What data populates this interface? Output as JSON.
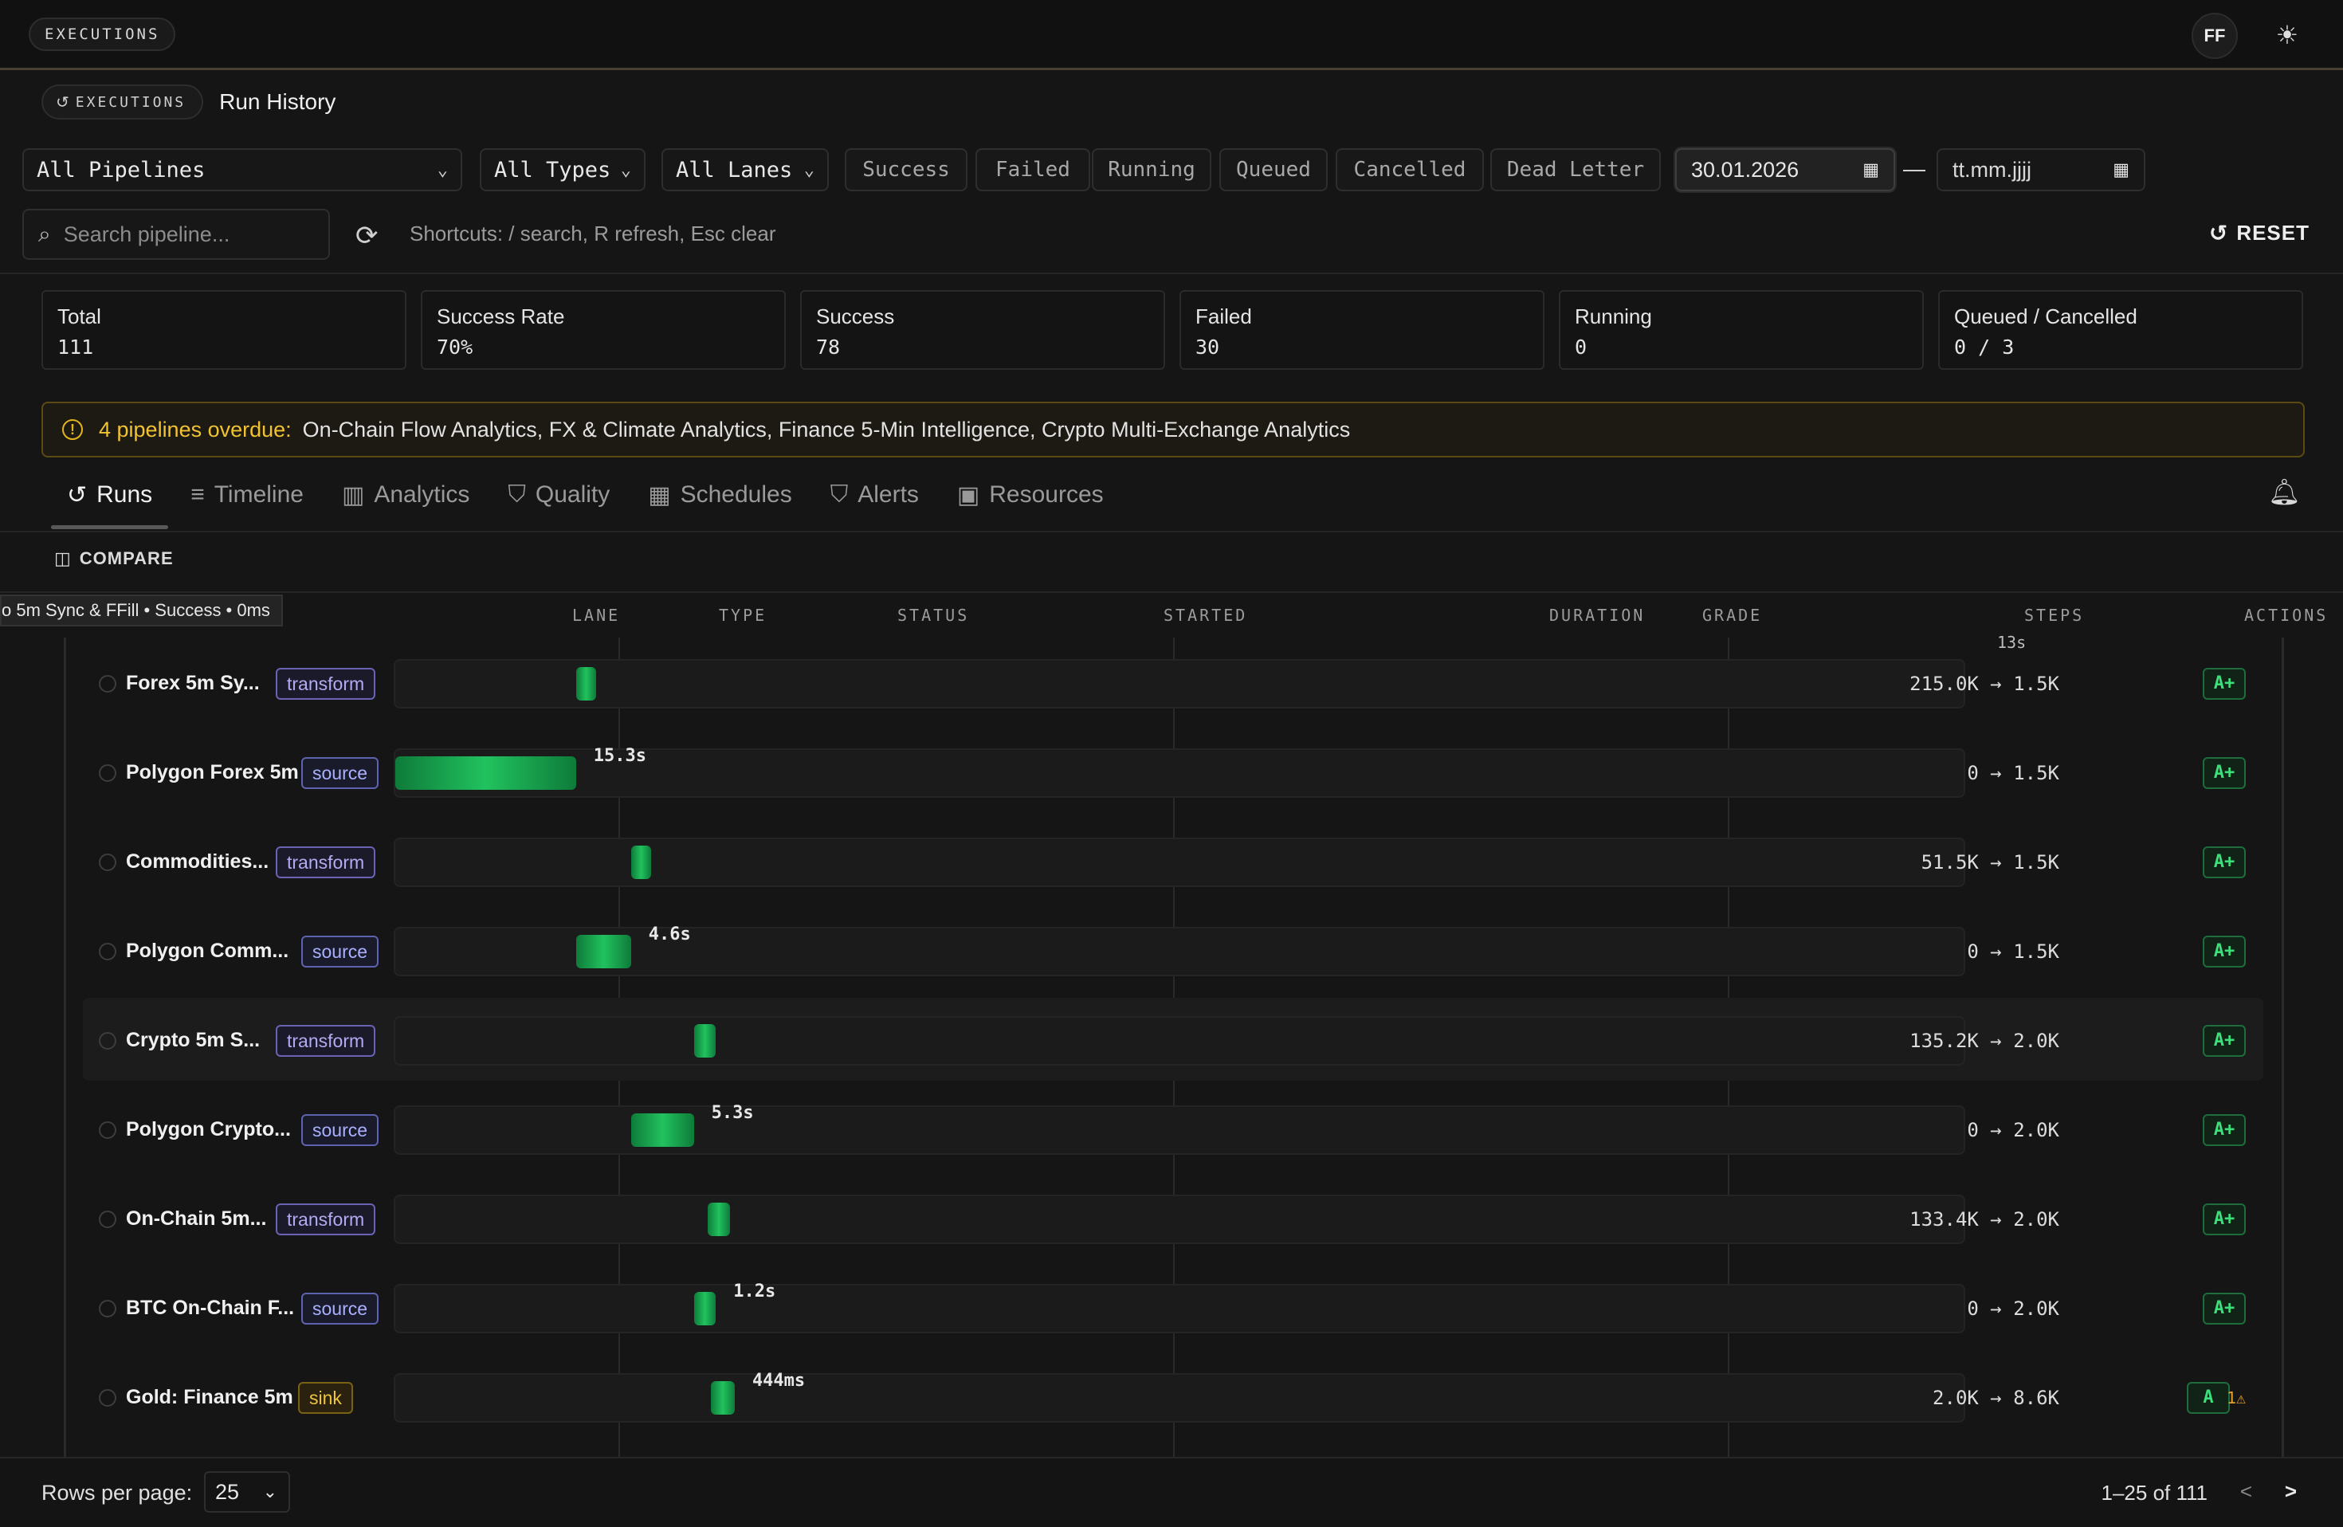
{
  "topbar": {
    "brand": "EXECUTIONS",
    "avatar": "FF",
    "theme_icon": "sun-icon"
  },
  "breadcrumb": {
    "section": "EXECUTIONS",
    "title": "Run History"
  },
  "filters": {
    "pipeline": "All Pipelines",
    "type": "All Types",
    "lane": "All Lanes",
    "statuses": [
      "Success",
      "Failed",
      "Running",
      "Queued",
      "Cancelled",
      "Dead Letter"
    ],
    "date_from": "30.01.2026",
    "date_sep": "—",
    "date_to_placeholder": "tt.mm.jjjj"
  },
  "search": {
    "placeholder": "Search pipeline...",
    "shortcuts": "Shortcuts: / search, R refresh, Esc clear",
    "reset": "RESET"
  },
  "stats": [
    {
      "label": "Total",
      "value": "111"
    },
    {
      "label": "Success Rate",
      "value": "70%"
    },
    {
      "label": "Success",
      "value": "78"
    },
    {
      "label": "Failed",
      "value": "30"
    },
    {
      "label": "Running",
      "value": "0"
    },
    {
      "label": "Queued / Cancelled",
      "value": "0 / 3"
    }
  ],
  "alert": {
    "headline": "4 pipelines overdue:",
    "names": "On-Chain Flow Analytics, FX & Climate Analytics, Finance 5-Min Intelligence, Crypto Multi-Exchange Analytics"
  },
  "tabs": [
    "Runs",
    "Timeline",
    "Analytics",
    "Quality",
    "Schedules",
    "Alerts",
    "Resources"
  ],
  "toolbar": {
    "compare": "COMPARE"
  },
  "tooltip": "o 5m Sync & FFill • Success • 0ms",
  "columns": [
    "LANE",
    "TYPE",
    "STATUS",
    "STARTED",
    "DURATION",
    "GRADE",
    "STEPS",
    "ACTIONS"
  ],
  "top_stub": "13s",
  "rows": [
    {
      "name": "Forex 5m Sy...",
      "lane": "transform",
      "dur": "",
      "start": 0.115,
      "width": 0.013,
      "steps": "215.0K → 1.5K",
      "grade": "A+",
      "warn": ""
    },
    {
      "name": "Polygon Forex 5m",
      "lane": "source",
      "dur": "15.3s",
      "start": 0.0,
      "width": 0.115,
      "steps": "0 → 1.5K",
      "grade": "A+",
      "warn": ""
    },
    {
      "name": "Commodities...",
      "lane": "transform",
      "dur": "",
      "start": 0.15,
      "width": 0.013,
      "steps": "51.5K → 1.5K",
      "grade": "A+",
      "warn": ""
    },
    {
      "name": "Polygon Comm...",
      "lane": "source",
      "dur": "4.6s",
      "start": 0.115,
      "width": 0.035,
      "steps": "0 → 1.5K",
      "grade": "A+",
      "warn": ""
    },
    {
      "name": "Crypto 5m S...",
      "lane": "transform",
      "dur": "",
      "start": 0.19,
      "width": 0.014,
      "steps": "135.2K → 2.0K",
      "grade": "A+",
      "warn": ""
    },
    {
      "name": "Polygon Crypto...",
      "lane": "source",
      "dur": "5.3s",
      "start": 0.15,
      "width": 0.04,
      "steps": "0 → 2.0K",
      "grade": "A+",
      "warn": ""
    },
    {
      "name": "On-Chain 5m...",
      "lane": "transform",
      "dur": "",
      "start": 0.199,
      "width": 0.014,
      "steps": "133.4K → 2.0K",
      "grade": "A+",
      "warn": ""
    },
    {
      "name": "BTC On-Chain F...",
      "lane": "source",
      "dur": "1.2s",
      "start": 0.19,
      "width": 0.014,
      "steps": "0 → 2.0K",
      "grade": "A+",
      "warn": ""
    },
    {
      "name": "Gold: Finance 5m",
      "lane": "sink",
      "dur": "444ms",
      "start": 0.201,
      "width": 0.015,
      "steps": "2.0K → 8.6K",
      "grade": "A",
      "warn": "1⚠"
    }
  ],
  "footer": {
    "rows_per_page_label": "Rows per page:",
    "rows_per_page": "25",
    "page_info": "1–25 of 111",
    "prev": "<",
    "next": ">"
  }
}
